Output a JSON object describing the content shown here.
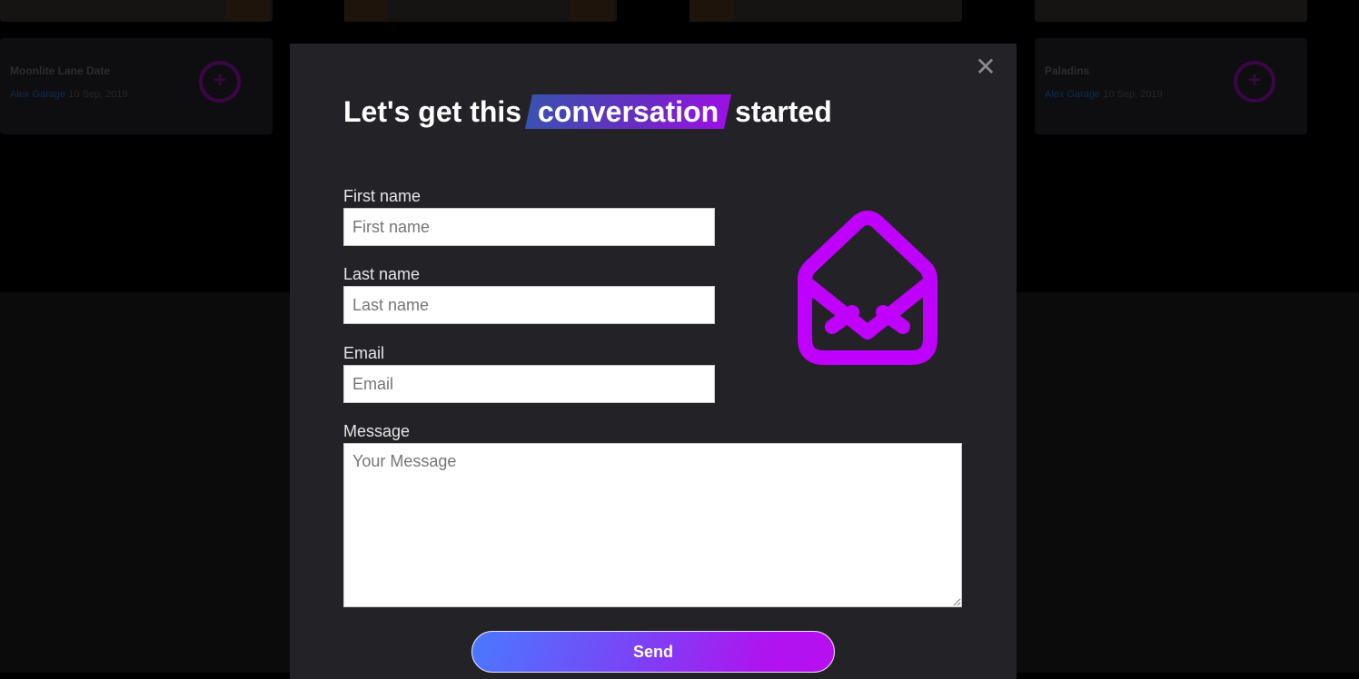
{
  "background": {
    "cards": [
      {
        "title": "Moonlite Lane Date",
        "author": "Alex Garage",
        "date": "10 Sep, 2019"
      },
      {
        "title": "Paladins",
        "author": "Alex Garage",
        "date": "10 Sep, 2019"
      }
    ]
  },
  "modal": {
    "close_glyph": "✕",
    "heading": {
      "before": "Let's get this",
      "highlight": "conversation",
      "after": "started"
    },
    "form": {
      "first_name": {
        "label": "First name",
        "placeholder": "First name",
        "value": ""
      },
      "last_name": {
        "label": "Last name",
        "placeholder": "Last name",
        "value": ""
      },
      "email": {
        "label": "Email",
        "placeholder": "Email",
        "value": ""
      },
      "message": {
        "label": "Message",
        "placeholder": "Your Message",
        "value": ""
      }
    },
    "send_label": "Send",
    "illustration_icon": "open-envelope-icon",
    "colors": {
      "accent": "#c000ff",
      "button_start": "#4a79ff",
      "button_end": "#b90ef0",
      "highlight_start": "#3a51b0",
      "highlight_end": "#9b10e6"
    }
  }
}
